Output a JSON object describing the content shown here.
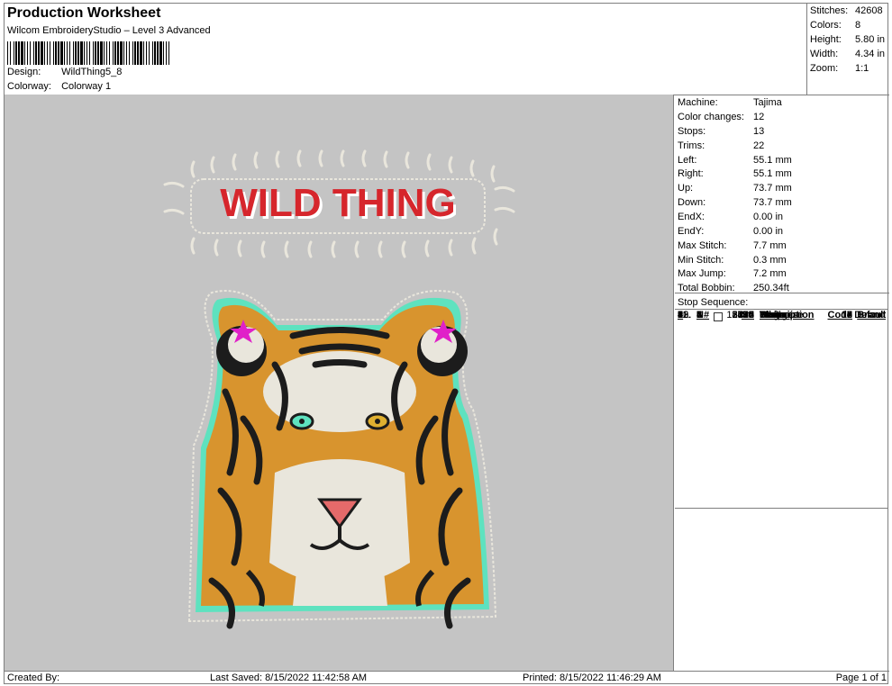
{
  "header": {
    "title": "Production Worksheet",
    "subtitle": "Wilcom EmbroideryStudio – Level 3 Advanced",
    "design_label": "Design:",
    "design_value": "WildThing5_8",
    "colorway_label": "Colorway:",
    "colorway_value": "Colorway 1"
  },
  "stats": {
    "stitches_label": "Stitches:",
    "stitches_value": "42608",
    "colors_label": "Colors:",
    "colors_value": "8",
    "height_label": "Height:",
    "height_value": "5.80 in",
    "width_label": "Width:",
    "width_value": "4.34 in",
    "zoom_label": "Zoom:",
    "zoom_value": "1:1"
  },
  "machine_info": [
    {
      "label": "Machine:",
      "value": "Tajima"
    },
    {
      "label": "Color changes:",
      "value": "12"
    },
    {
      "label": "Stops:",
      "value": "13"
    },
    {
      "label": "Trims:",
      "value": "22"
    },
    {
      "label": "Left:",
      "value": "55.1 mm"
    },
    {
      "label": "Right:",
      "value": "55.1 mm"
    },
    {
      "label": "Up:",
      "value": "73.7 mm"
    },
    {
      "label": "Down:",
      "value": "73.7 mm"
    },
    {
      "label": "EndX:",
      "value": "0.00 in"
    },
    {
      "label": "EndY:",
      "value": "0.00 in"
    },
    {
      "label": "Max Stitch:",
      "value": "7.7 mm"
    },
    {
      "label": "Min Stitch:",
      "value": "0.3 mm"
    },
    {
      "label": "Max Jump:",
      "value": "7.2 mm"
    },
    {
      "label": "Total Bobbin:",
      "value": "250.34ft"
    }
  ],
  "stop_sequence": {
    "title": "Stop Sequence:",
    "columns": {
      "num": "#",
      "needle": "N#",
      "stitches": "St.",
      "description": "Description",
      "code": "Code",
      "brand": "Brand"
    },
    "rows": [
      {
        "num": "1.",
        "needle": "5",
        "color": "#ffffff",
        "stitches": "3140",
        "description": "White",
        "code": "13",
        "brand": "Default"
      },
      {
        "num": "2.",
        "needle": "1",
        "color": "#e01010",
        "stitches": "1604",
        "description": "Red",
        "code": "3",
        "brand": "Default"
      },
      {
        "num": "3.",
        "needle": "4",
        "color": "#8b5a2b",
        "stitches": "2745",
        "description": "Brown",
        "code": "12",
        "brand": "Default"
      },
      {
        "num": "4.",
        "needle": "5",
        "color": "#ffffff",
        "stitches": "3496",
        "description": "White",
        "code": "13",
        "brand": "Default"
      },
      {
        "num": "5.",
        "needle": "3",
        "color": "#f0962a",
        "stitches": "8410",
        "description": "Orange",
        "code": "10",
        "brand": "Default"
      },
      {
        "num": "6.",
        "needle": "7",
        "color": "#e8505a",
        "stitches": "334",
        "description": "Pink",
        "code": "15",
        "brand": "Default"
      },
      {
        "num": "7.",
        "needle": "6",
        "color": "#000000",
        "stitches": "13713",
        "description": "Black",
        "code": "14",
        "brand": "Default"
      },
      {
        "num": "8.",
        "needle": "8",
        "color": "#4de0c0",
        "stitches": "320",
        "description": "Turquoise",
        "code": "17",
        "brand": "Default"
      },
      {
        "num": "9.",
        "needle": "5",
        "color": "#ffffff",
        "stitches": "5106",
        "description": "White",
        "code": "13",
        "brand": "Default"
      },
      {
        "num": "10.",
        "needle": "3",
        "color": "#f0962a",
        "stitches": "164",
        "description": "Orange",
        "code": "10",
        "brand": "Default"
      },
      {
        "num": "11.",
        "needle": "2",
        "color": "#e010e0",
        "stitches": "362",
        "description": "Magenta",
        "code": "6",
        "brand": "Default"
      },
      {
        "num": "12.",
        "needle": "8",
        "color": "#4de0c0",
        "stitches": "2535",
        "description": "Turquoise",
        "code": "17",
        "brand": "Default"
      },
      {
        "num": "13.",
        "needle": "5",
        "color": "#ffffff",
        "stitches": "677",
        "description": "White",
        "code": "13",
        "brand": "Default"
      }
    ]
  },
  "design_art": {
    "text": "WILD THING",
    "colors": {
      "canvas": "#c4c4c4",
      "red": "#d6262c",
      "orange": "#d8942e",
      "black": "#1c1c1c",
      "white": "#e9e6dc",
      "turquoise": "#5ee2bf",
      "pink": "#e56a6a",
      "magenta": "#e020c8",
      "brown": "#7a4a22"
    }
  },
  "footer": {
    "created": "Created By:",
    "last_saved": "Last Saved: 8/15/2022 11:42:58 AM",
    "printed": "Printed: 8/15/2022 11:46:29 AM",
    "page": "Page 1 of 1"
  }
}
